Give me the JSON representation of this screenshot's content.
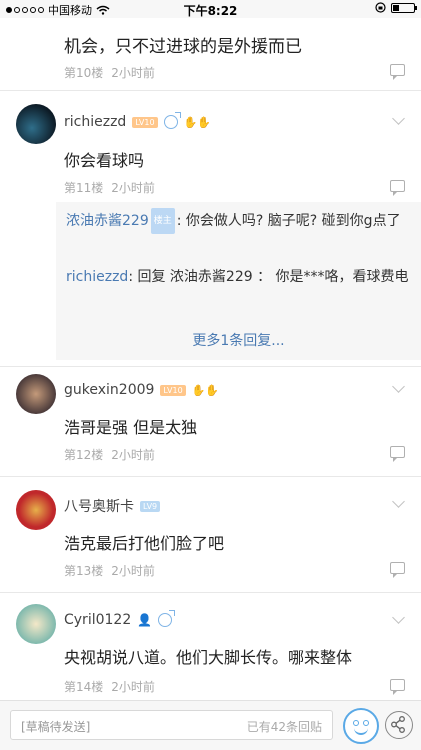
{
  "status_bar": {
    "carrier": "中国移动",
    "time": "下午8:22"
  },
  "posts": [
    {
      "text": "机会，只不过进球的是外援而已",
      "floor": "第10楼",
      "time": "2小时前"
    },
    {
      "username": "richiezzd",
      "level": "LV10",
      "comment": "你会看球吗",
      "floor": "第11楼",
      "time": "2小时前"
    },
    {
      "username": "gukexin2009",
      "level": "LV10",
      "comment": "浩哥是强 但是太独",
      "floor": "第12楼",
      "time": "2小时前"
    },
    {
      "username": "八号奥斯卡",
      "level": "LV9",
      "comment": "浩克最后打他们脸了吧",
      "floor": "第13楼",
      "time": "2小时前"
    },
    {
      "username": "Cyril0122",
      "comment": "央视胡说八道。他们大脚长传。哪来整体",
      "floor": "第14楼",
      "time": "2小时前"
    }
  ],
  "subreplies": {
    "items": [
      {
        "user": "浓油赤酱229",
        "badge": "楼主",
        "text": ": 你会做人吗? 脑子呢? 碰到你g点了"
      },
      {
        "user": "richiezzd",
        "text": ": 回复 浓油赤酱229 ： 你是***咯，看球费电"
      }
    ],
    "more_label": "更多1条回复..."
  },
  "bottom_bar": {
    "draft_placeholder": "[草稿待发送]",
    "reply_count": "已有42条回贴"
  },
  "colors": {
    "link_blue": "#4a7ab2",
    "meta_gray": "#aaaaaa",
    "accent_blue": "#5aa9e6"
  }
}
